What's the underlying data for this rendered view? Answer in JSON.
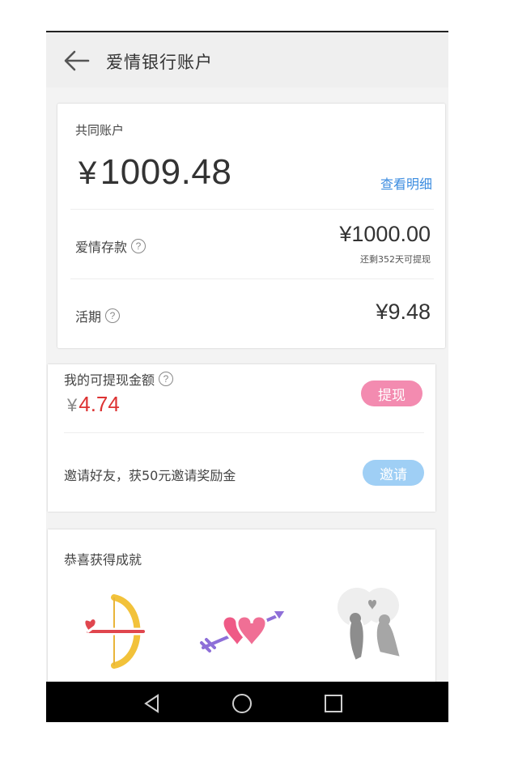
{
  "header": {
    "title": "爱情银行账户",
    "back_icon": "arrow-left-icon"
  },
  "joint_account": {
    "label": "共同账户",
    "currency": "¥",
    "balance": "1009.48",
    "detail_link": "查看明细",
    "detail_color": "#3d8de0"
  },
  "love_deposit": {
    "label": "爱情存款",
    "help": "?",
    "value": "¥1000.00",
    "note": "还剩352天可提现"
  },
  "current": {
    "label": "活期",
    "help": "?",
    "value": "¥9.48"
  },
  "withdrawable": {
    "label": "我的可提现金额",
    "help": "?",
    "currency": "¥",
    "amount": "4.74",
    "amount_color": "#d33333",
    "withdraw_button": "提现",
    "withdraw_color": "#f38bb0"
  },
  "invite": {
    "text": "邀请好友，获50元邀请奖励金",
    "button": "邀请",
    "button_color": "#9fcff5"
  },
  "achievements": {
    "title": "恭喜获得成就",
    "badges": [
      "cupid-bow-badge-icon",
      "hearts-arrow-badge-icon",
      "lovebirds-badge-icon"
    ]
  },
  "navbar": {
    "icons": [
      "back-triangle-icon",
      "home-circle-icon",
      "recents-square-icon"
    ]
  }
}
